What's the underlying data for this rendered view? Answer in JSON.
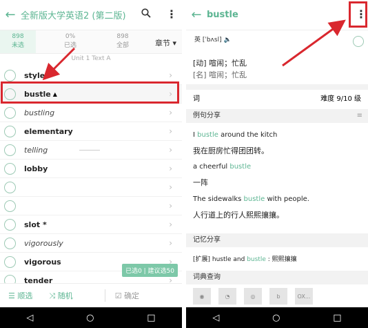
{
  "left": {
    "title": "全新版大学英语2 (第二版)",
    "stats": [
      {
        "num": "898",
        "label": "未选"
      },
      {
        "num": "0%",
        "label": "已选"
      },
      {
        "num": "898",
        "label": "全部"
      }
    ],
    "chapter": "章节",
    "unit": "Unit 1 Text A",
    "words": [
      "style",
      "bustle",
      "bustling",
      "elementary",
      "telling",
      "lobby",
      "",
      "",
      "slot *",
      "vigorously",
      "vigorous",
      "tender"
    ],
    "counter": "已选0 | 建议选50",
    "bottom": {
      "order": "顺选",
      "random": "随机",
      "confirm": "确定"
    }
  },
  "right": {
    "title": "bustle",
    "phonetic": "英 [ˈbʌsl]",
    "def1": "[动] 喧闹；忙乱",
    "def2": "[名] 喧闹；忙乱",
    "word_label": "词",
    "difficulty": "难度 9/10 级",
    "examples_header": "例句分享",
    "ex1_pre": "I ",
    "ex1_hl": "bustle",
    "ex1_post": " around the kitch",
    "ex1_cn": "我在厨房忙得团团转。",
    "ex2_pre": "a cheerful ",
    "ex2_hl": "bustle",
    "ex2_cn": "一阵",
    "ex3_pre": "The sidewalks ",
    "ex3_hl": "bustle",
    "ex3_post": " with people.",
    "ex3_cn": "人行道上的行人熙熙攘攘。",
    "memory_header": "记忆分享",
    "memory_text_pre": "[扩展] hustle and ",
    "memory_text_hl": "bustle",
    "memory_text_post": " : 熙熙攘攘",
    "dict_header": "词典查询",
    "dict_last": "OX..."
  },
  "nav": {
    "back": "◁",
    "home": "○",
    "recent": "□"
  },
  "colors": {
    "accent": "#5cb592",
    "annotation": "#d9272e"
  }
}
